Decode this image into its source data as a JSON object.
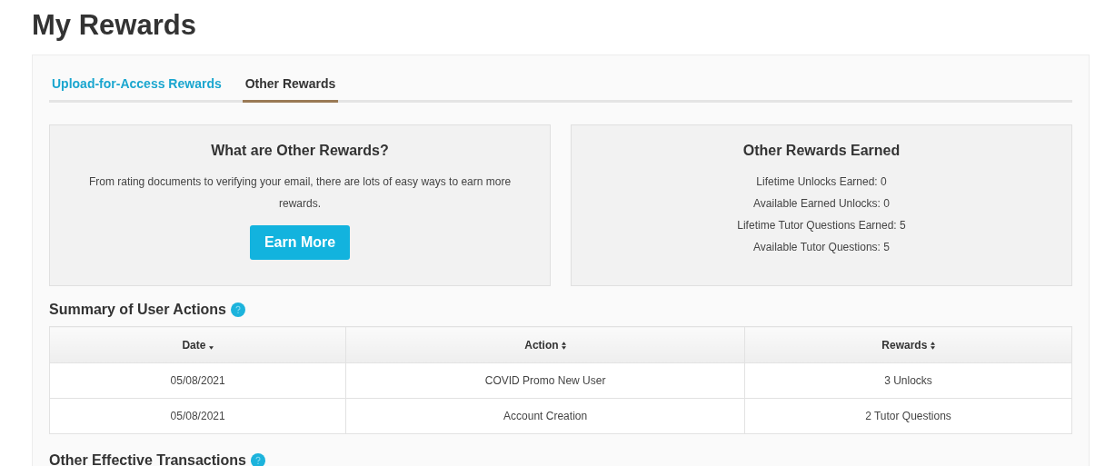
{
  "page_title": "My Rewards",
  "tabs": [
    {
      "label": "Upload-for-Access Rewards",
      "selected": false
    },
    {
      "label": "Other Rewards",
      "selected": true
    }
  ],
  "info_card": {
    "title": "What are Other Rewards?",
    "text": "From rating documents to verifying your email, there are lots of easy ways to earn more rewards.",
    "button": "Earn More"
  },
  "earned_card": {
    "title": "Other Rewards Earned",
    "lines": [
      "Lifetime Unlocks Earned: 0",
      "Available Earned Unlocks: 0",
      "Lifetime Tutor Questions Earned: 5",
      "Available Tutor Questions: 5"
    ]
  },
  "summary": {
    "title": "Summary of User Actions",
    "columns": [
      {
        "label": "Date",
        "sorted": true
      },
      {
        "label": "Action",
        "sorted": false
      },
      {
        "label": "Rewards",
        "sorted": false
      }
    ],
    "rows": [
      [
        "05/08/2021",
        "COVID Promo New User",
        "3 Unlocks"
      ],
      [
        "05/08/2021",
        "Account Creation",
        "2 Tutor Questions"
      ]
    ]
  },
  "next_section": {
    "title": "Other Effective Transactions"
  }
}
